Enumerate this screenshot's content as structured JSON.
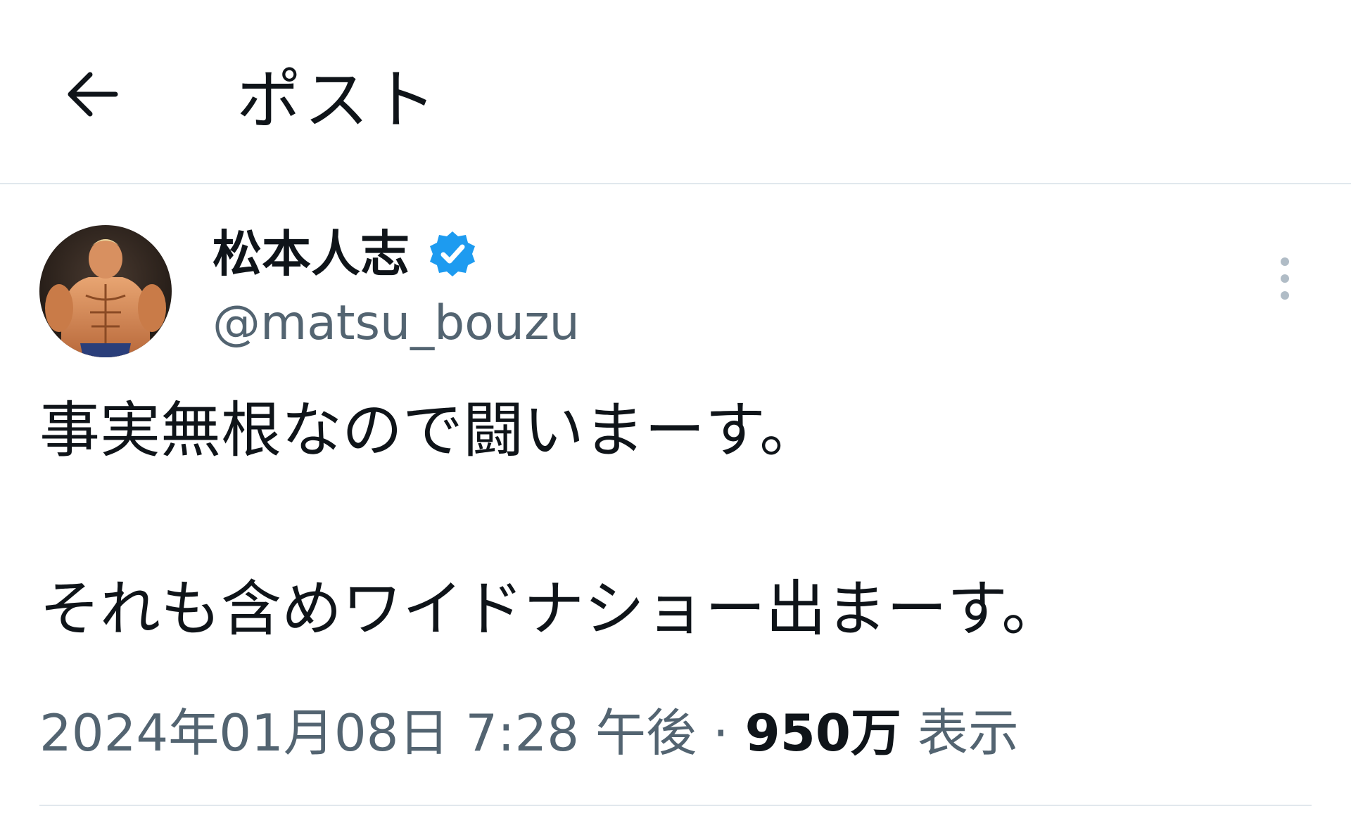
{
  "header": {
    "title": "ポスト",
    "back_icon": "arrow-left-icon"
  },
  "post": {
    "display_name": "松本人志",
    "verified": true,
    "verified_color": "#1d9bf0",
    "handle": "@matsu_bouzu",
    "text_line_1": "事実無根なので闘いまーす。",
    "text_line_2": "それも含めワイドナショー出まーす。",
    "date": "2024年01月08日",
    "time": "7:28 午後",
    "separator": "·",
    "views_count": "950万",
    "views_label": "表示",
    "more_icon": "more-vertical-icon"
  },
  "colors": {
    "text_primary": "#0f1419",
    "text_secondary": "#536471",
    "divider": "#e1e8ed"
  }
}
